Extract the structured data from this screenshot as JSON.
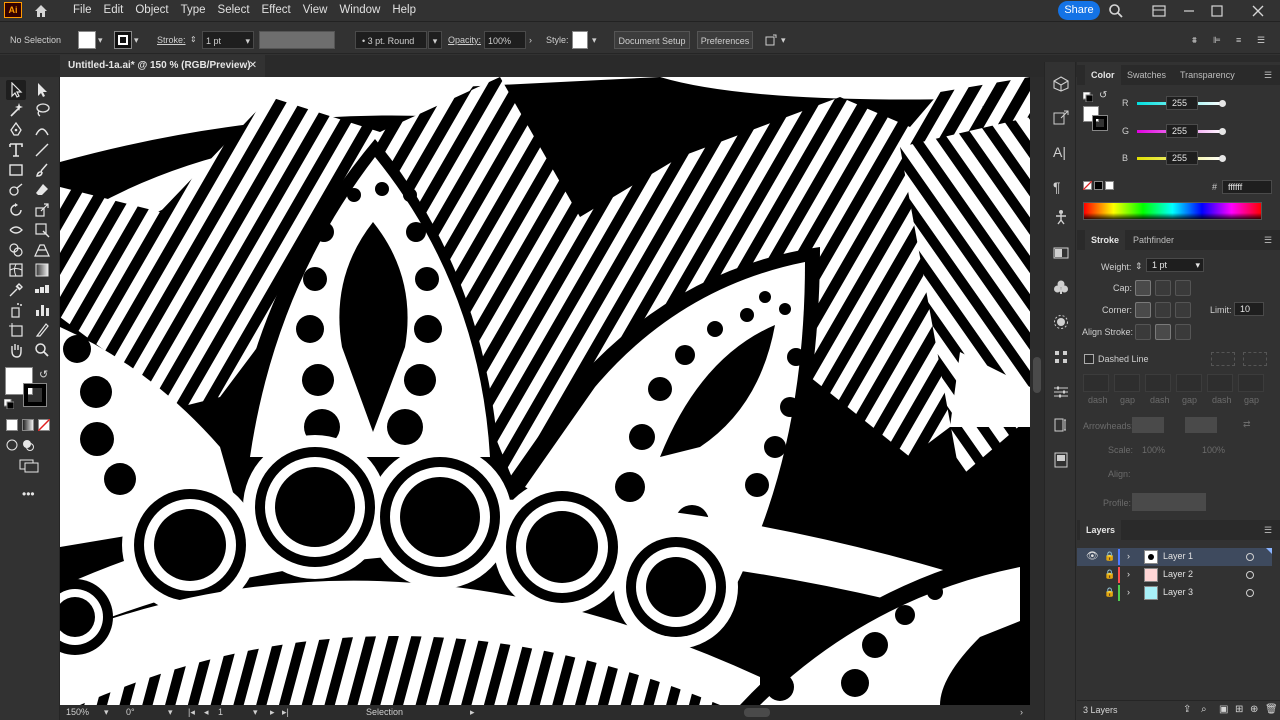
{
  "app": {
    "logo": "Ai",
    "menu": [
      "File",
      "Edit",
      "Object",
      "Type",
      "Select",
      "Effect",
      "View",
      "Window",
      "Help"
    ],
    "share_label": "Share"
  },
  "control_bar": {
    "selection_label": "No Selection",
    "stroke_label": "Stroke:",
    "stroke_weight": "1 pt",
    "brush_label": "3 pt. Round",
    "opacity_label": "Opacity:",
    "opacity_value": "100%",
    "style_label": "Style:",
    "document_setup_label": "Document Setup",
    "preferences_label": "Preferences"
  },
  "document": {
    "tab_title": "Untitled-1a.ai* @ 150 % (RGB/Preview)",
    "close_glyph": "✕"
  },
  "status_bar": {
    "zoom": "150%",
    "rotation": "0°",
    "artboard_number": "1",
    "tool_name": "Selection"
  },
  "color_panel": {
    "tabs": [
      "Color",
      "Swatches",
      "Transparency"
    ],
    "channels": [
      {
        "label": "R",
        "value": "255",
        "color": "#00d8e0"
      },
      {
        "label": "G",
        "value": "255",
        "color": "#e040e0"
      },
      {
        "label": "B",
        "value": "255",
        "color": "#e8e800"
      }
    ],
    "hex_prefix": "#",
    "hex_value": "ffffff"
  },
  "stroke_panel": {
    "tabs": [
      "Stroke",
      "Pathfinder"
    ],
    "weight_label": "Weight:",
    "weight_value": "1 pt",
    "cap_label": "Cap:",
    "corner_label": "Corner:",
    "limit_label": "Limit:",
    "limit_value": "10",
    "align_label": "Align Stroke:",
    "dashed_label": "Dashed Line",
    "dash_labels": [
      "dash",
      "gap",
      "dash",
      "gap",
      "dash",
      "gap"
    ],
    "arrowheads_label": "Arrowheads:",
    "scale_label": "Scale:",
    "scale_values": [
      "100%",
      "100%"
    ],
    "align_arrow_label": "Align:",
    "profile_label": "Profile:"
  },
  "layers_panel": {
    "tab": "Layers",
    "layers": [
      {
        "name": "Layer 1",
        "color": "#4f7bff"
      },
      {
        "name": "Layer 2",
        "color": "#ff4f4f"
      },
      {
        "name": "Layer 3",
        "color": "#4fcf4f"
      }
    ],
    "count_label": "3 Layers"
  },
  "accent_color": "#1473e6"
}
